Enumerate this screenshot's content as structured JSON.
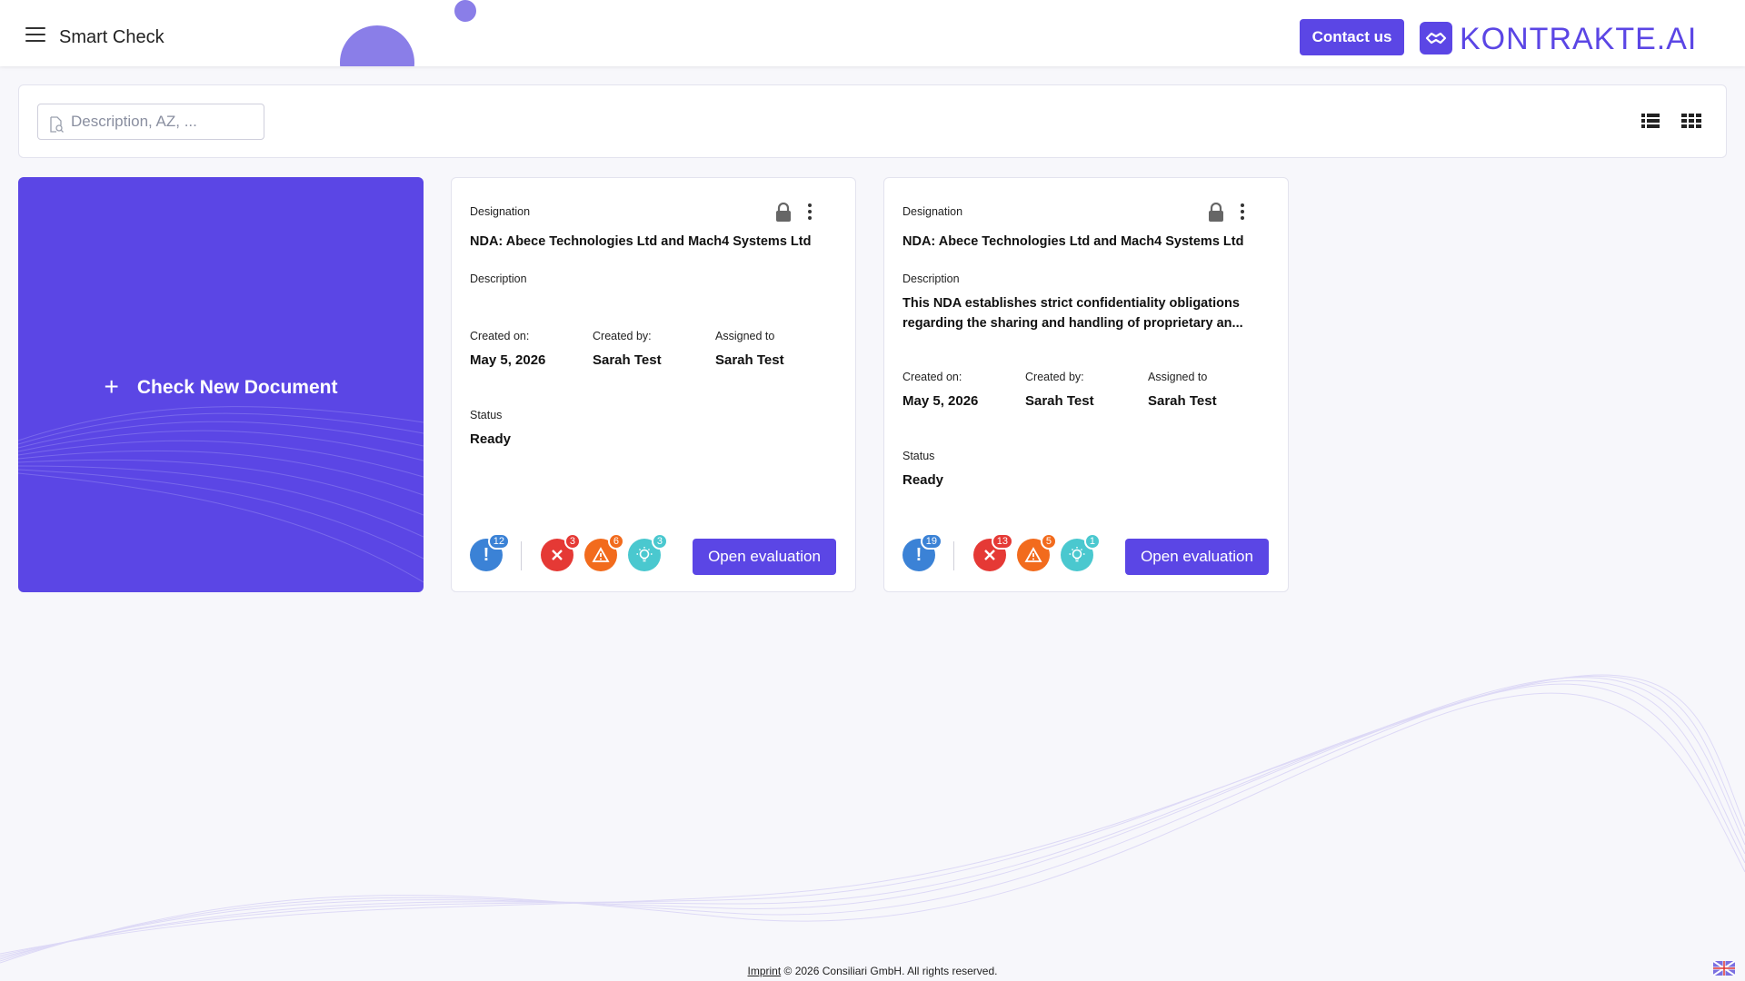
{
  "header": {
    "title": "Smart Check",
    "contact_label": "Contact us",
    "brand_name": "KONTRAKTE.AI"
  },
  "search": {
    "placeholder": "Description, AZ, ..."
  },
  "new_document": {
    "label": "Check New Document"
  },
  "cards": [
    {
      "designation_label": "Designation",
      "designation": "NDA: Abece Technologies Ltd and Mach4 Systems Ltd",
      "description_label": "Description",
      "description": "",
      "created_on_label": "Created on:",
      "created_on": "May 5, 2026",
      "created_by_label": "Created by:",
      "created_by": "Sarah Test",
      "assigned_to_label": "Assigned to",
      "assigned_to": "Sarah Test",
      "status_label": "Status",
      "status": "Ready",
      "badges": {
        "info": "12",
        "error": "3",
        "warning": "6",
        "tip": "3"
      },
      "open_label": "Open evaluation"
    },
    {
      "designation_label": "Designation",
      "designation": "NDA: Abece Technologies Ltd and Mach4 Systems Ltd",
      "description_label": "Description",
      "description": "This NDA establishes strict confidentiality obligations regarding the sharing and handling of proprietary an...",
      "created_on_label": "Created on:",
      "created_on": "May 5, 2026",
      "created_by_label": "Created by:",
      "created_by": "Sarah Test",
      "assigned_to_label": "Assigned to",
      "assigned_to": "Sarah Test",
      "status_label": "Status",
      "status": "Ready",
      "badges": {
        "info": "19",
        "error": "13",
        "warning": "5",
        "tip": "1"
      },
      "open_label": "Open evaluation"
    }
  ],
  "footer": {
    "imprint": "Imprint",
    "copyright": " © 2026 Consiliari GmbH. All rights reserved."
  },
  "colors": {
    "brand": "#5b46e5",
    "info": "#3b82d6",
    "error": "#e53935",
    "warning": "#f26b1d",
    "tip": "#4ac8cf"
  },
  "icons": {
    "menu": "hamburger-icon",
    "lock": "lock-icon",
    "more": "kebab-icon",
    "info": "exclamation-icon",
    "error": "cross-icon",
    "warning": "warning-icon",
    "tip": "lightbulb-icon",
    "list_view": "list-view-icon",
    "grid_view": "grid-view-icon",
    "language": "flag-uk-icon"
  }
}
